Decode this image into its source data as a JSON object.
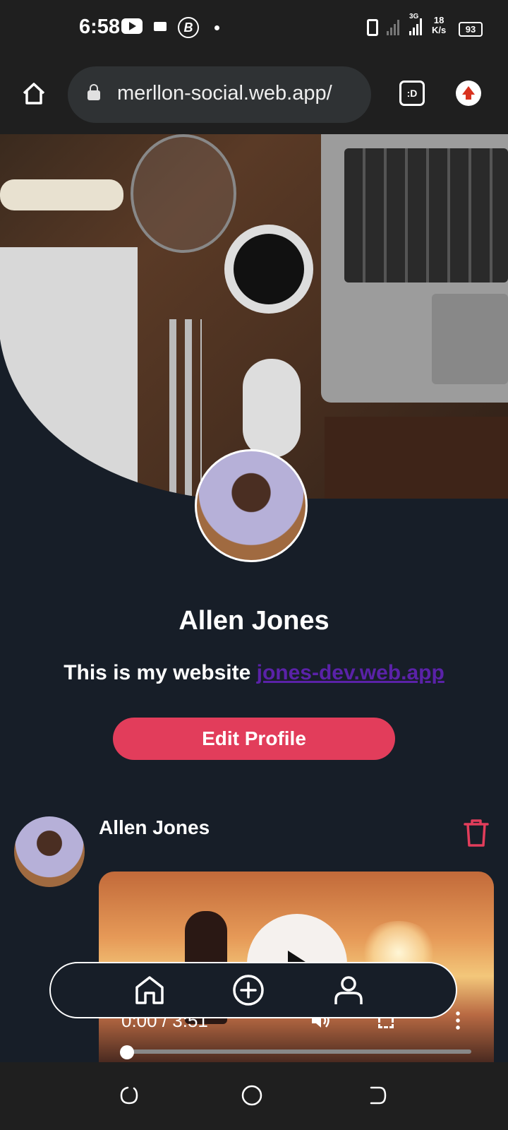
{
  "status_bar": {
    "time": "6:58",
    "network_label": "3G",
    "speed_value": "18",
    "speed_unit": "K/s",
    "battery": "93",
    "icons": [
      "youtube-icon",
      "message-icon",
      "bitcoin-icon",
      "dot-icon",
      "vibrate-icon",
      "signal-icon",
      "signal-icon",
      "battery-icon"
    ]
  },
  "browser": {
    "url": "merllon-social.web.app/",
    "tabs_label": ":D",
    "icons": [
      "home-icon",
      "lock-icon",
      "tabs-icon",
      "upload-arrow-icon"
    ]
  },
  "profile": {
    "name": "Allen Jones",
    "bio_text": "This is my website",
    "bio_link": "jones-dev.web.app",
    "edit_button": "Edit Profile"
  },
  "post": {
    "author": "Allen Jones",
    "video_time": "0:00 / 3:51",
    "video_progress": 0.0,
    "icons": [
      "trash-icon",
      "play-icon",
      "volume-icon",
      "fullscreen-icon",
      "more-vertical-icon"
    ]
  },
  "bottom_nav": {
    "items": [
      "home-icon",
      "add-circle-icon",
      "user-icon"
    ]
  },
  "system_nav": {
    "items": [
      "recent-apps-icon",
      "home-circle-icon",
      "back-icon"
    ]
  },
  "colors": {
    "background": "#171e28",
    "accent": "#e23d5b",
    "link": "#5a22a8",
    "browser_chrome": "#1f1f1f"
  }
}
